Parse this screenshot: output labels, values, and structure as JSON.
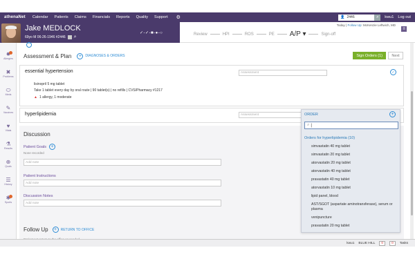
{
  "topnav": {
    "brand": "athenaNet",
    "items": [
      "Calendar",
      "Patients",
      "Claims",
      "Financials",
      "Reports",
      "Quality",
      "Support"
    ],
    "user_search_value": "2446",
    "username": "kwu1",
    "logout": "Log out"
  },
  "patient": {
    "name": "Jake MEDLOCK",
    "info": "69yo M  06-26-1946  #2446",
    "vitals_mini": "✓-✓-■-●-○"
  },
  "steps": [
    "Review",
    "HPI",
    "ROS",
    "PE",
    "A/P",
    "Sign-off"
  ],
  "active_step": "A/P ▾",
  "today": {
    "prefix": "Today | ",
    "link": "Follow Up",
    "suffix": ": McKenzie Leftwich, MD"
  },
  "sidebar": [
    "Allergies",
    "Problems",
    "Meds",
    "Vaccines",
    "Vitals",
    "Results",
    "Quals",
    "History",
    "Sports"
  ],
  "ap": {
    "title": "Assessment & Plan",
    "link": "DIAGNOSES & ORDERS",
    "sign_btn": "Sign Orders (1)",
    "next_btn": "Next"
  },
  "diagnoses": [
    {
      "title": "essential hypertension",
      "assessment_placeholder": "Assessment",
      "med_name": "lisinopril 5 mg tablet",
      "med_sig": "Take 1 tablet every day by oral route  |  90 tablet(s)  |  no refills  |  CVS/Pharmacy #1217",
      "warning": "1 allergy, 1 moderate"
    },
    {
      "title": "hyperlipidemia",
      "assessment_placeholder": "Assessment"
    }
  ],
  "discussion": {
    "title": "Discussion",
    "patient_goals": "Patient Goals",
    "patient_goals_sub": "None recorded",
    "note_placeholder": "Add note",
    "instructions": "Patient Instructions",
    "notes": "Discussion Notes"
  },
  "followup": {
    "title": "Follow Up",
    "link": "RETURN TO OFFICE",
    "sub": "Patient not return to the office as needed"
  },
  "order_dropdown": {
    "label": "ORDER",
    "search_value": "|",
    "section": "Orders for hyperlipidemia (10)",
    "items": [
      "simvastatin 40 mg tablet",
      "simvastatin 20 mg tablet",
      "atorvastatin 20 mg tablet",
      "atorvastatin 40 mg tablet",
      "pravastatin 40 mg tablet",
      "atorvastatin 10 mg tablet",
      "lipid panel, blood",
      "AST/SGOT (aspartate aminotransferase), serum or plasma",
      "venipuncture",
      "pravastatin 20 mg tablet"
    ]
  },
  "statusbar": {
    "user": "kwu1",
    "dept": "BLUE HILL",
    "count1": "0",
    "count2": "0",
    "tasks": "Tasks"
  }
}
